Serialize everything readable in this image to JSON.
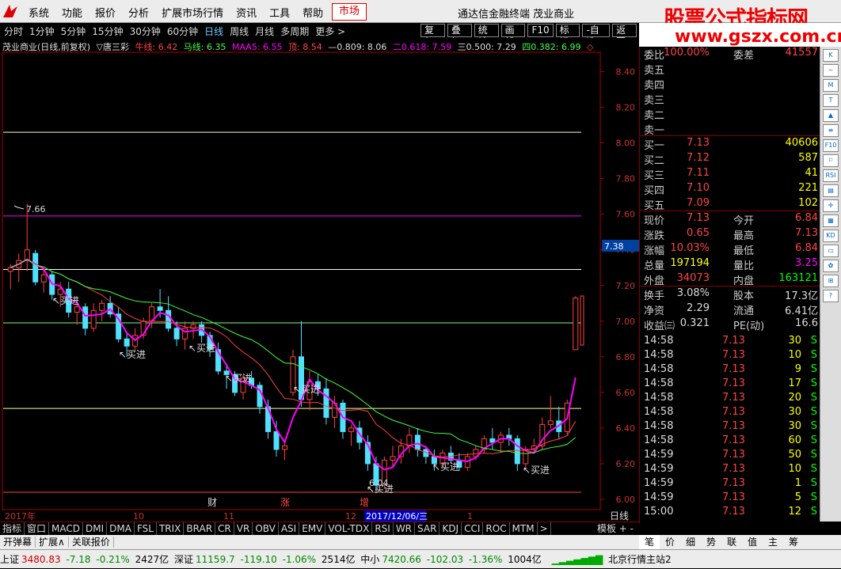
{
  "menubar": {
    "items": [
      "系统",
      "功能",
      "报价",
      "分析",
      "扩展市场行情",
      "资讯",
      "工具",
      "帮助"
    ],
    "active": "市场",
    "title": "通达信金融终端 茂业商业",
    "brand": "股票公式指标网"
  },
  "urlbar": {
    "url": "www.gszx.com.cn"
  },
  "toolbar": {
    "periods": [
      "分时",
      "1分钟",
      "5分钟",
      "15分钟",
      "30分钟",
      "60分钟",
      "日线",
      "周线",
      "月线",
      "多周期",
      "更多 >"
    ],
    "selected": "日线",
    "tools": [
      "复权",
      "叠加",
      "统计",
      "画线",
      "F10",
      "标记",
      "-自选",
      "返回"
    ]
  },
  "legend": {
    "name": "茂业商业(日线,前复权)",
    "indicator": "▽唐三彩",
    "niu": "牛线: 6.42",
    "ma": "马线: 6.35",
    "maa": "MAA5: 6.55",
    "ding": "顶: 8.54",
    "g809": "—0.809: 8.06",
    "g618": "二0.618: 7.59",
    "g500": "三0.500: 7.29",
    "g382": "四0.382: 6.99"
  },
  "chart_data": {
    "type": "candlestick",
    "dates": [
      "2017年",
      "10",
      "11",
      "12",
      "2017/12/06/三",
      "1"
    ],
    "yticks": [
      8.4,
      8.2,
      8.0,
      7.8,
      7.6,
      7.4,
      7.2,
      7.0,
      6.8,
      6.6,
      6.4,
      6.2,
      6.0
    ],
    "ylim": [
      5.96,
      8.5
    ],
    "current_price": 7.38,
    "annotations": {
      "high_label": "7.66",
      "low_label": "6.04",
      "buy_label": "买进",
      "events": [
        "财",
        "涨",
        "增"
      ],
      "period_label": "日线"
    },
    "levels": [
      {
        "value": 8.06,
        "color": "#ffffc0"
      },
      {
        "value": 7.59,
        "color": "#ff00ff"
      },
      {
        "value": 7.29,
        "color": "#ffffff"
      },
      {
        "value": 6.99,
        "color": "#80ff80"
      },
      {
        "value": 6.51,
        "color": "#ffffa0"
      },
      {
        "value": 6.04,
        "color": "#ff4040"
      }
    ],
    "candles": [
      [
        7.28,
        7.32,
        7.18,
        7.3
      ],
      [
        7.3,
        7.38,
        7.22,
        7.34
      ],
      [
        7.34,
        7.66,
        7.28,
        7.4
      ],
      [
        7.38,
        7.4,
        7.2,
        7.22
      ],
      [
        7.22,
        7.3,
        7.16,
        7.26
      ],
      [
        7.26,
        7.28,
        7.12,
        7.15
      ],
      [
        7.15,
        7.22,
        7.08,
        7.18
      ],
      [
        7.18,
        7.22,
        7.02,
        7.05
      ],
      [
        7.05,
        7.12,
        6.98,
        7.08
      ],
      [
        7.08,
        7.1,
        6.92,
        6.96
      ],
      [
        6.96,
        7.1,
        6.94,
        7.06
      ],
      [
        7.06,
        7.12,
        7.0,
        7.1
      ],
      [
        7.1,
        7.14,
        7.02,
        7.04
      ],
      [
        7.04,
        7.08,
        6.88,
        6.9
      ],
      [
        6.9,
        6.94,
        6.8,
        6.86
      ],
      [
        6.86,
        6.96,
        6.84,
        6.92
      ],
      [
        6.92,
        7.02,
        6.9,
        7.0
      ],
      [
        7.0,
        7.1,
        6.96,
        7.08
      ],
      [
        7.08,
        7.18,
        7.02,
        7.06
      ],
      [
        7.06,
        7.14,
        6.94,
        6.96
      ],
      [
        6.96,
        7.0,
        6.86,
        6.9
      ],
      [
        6.9,
        7.0,
        6.84,
        6.96
      ],
      [
        6.96,
        7.0,
        6.9,
        6.98
      ],
      [
        6.98,
        7.0,
        6.88,
        6.92
      ],
      [
        6.92,
        6.94,
        6.8,
        6.84
      ],
      [
        6.84,
        6.88,
        6.7,
        6.72
      ],
      [
        6.72,
        6.76,
        6.62,
        6.7
      ],
      [
        6.7,
        6.72,
        6.58,
        6.6
      ],
      [
        6.6,
        6.7,
        6.56,
        6.68
      ],
      [
        6.68,
        6.72,
        6.62,
        6.64
      ],
      [
        6.64,
        6.66,
        6.48,
        6.52
      ],
      [
        6.52,
        6.56,
        6.34,
        6.38
      ],
      [
        6.38,
        6.44,
        6.24,
        6.28
      ],
      [
        6.28,
        6.32,
        6.22,
        6.3
      ],
      [
        6.6,
        6.84,
        6.58,
        6.8
      ],
      [
        6.8,
        7.0,
        6.52,
        6.56
      ],
      [
        6.56,
        6.72,
        6.5,
        6.66
      ],
      [
        6.66,
        6.7,
        6.58,
        6.62
      ],
      [
        6.62,
        6.68,
        6.42,
        6.46
      ],
      [
        6.46,
        6.58,
        6.4,
        6.54
      ],
      [
        6.54,
        6.56,
        6.34,
        6.38
      ],
      [
        6.38,
        6.42,
        6.3,
        6.4
      ],
      [
        6.4,
        6.44,
        6.28,
        6.32
      ],
      [
        6.32,
        6.36,
        6.16,
        6.2
      ],
      [
        6.2,
        6.24,
        6.04,
        6.08
      ],
      [
        6.08,
        6.24,
        6.06,
        6.22
      ],
      [
        6.22,
        6.3,
        6.18,
        6.24
      ],
      [
        6.24,
        6.34,
        6.2,
        6.3
      ],
      [
        6.3,
        6.4,
        6.26,
        6.36
      ],
      [
        6.36,
        6.4,
        6.24,
        6.28
      ],
      [
        6.28,
        6.3,
        6.2,
        6.24
      ],
      [
        6.24,
        6.28,
        6.16,
        6.2
      ],
      [
        6.2,
        6.28,
        6.18,
        6.26
      ],
      [
        6.26,
        6.3,
        6.2,
        6.22
      ],
      [
        6.22,
        6.26,
        6.16,
        6.18
      ],
      [
        6.18,
        6.26,
        6.16,
        6.24
      ],
      [
        6.24,
        6.3,
        6.22,
        6.28
      ],
      [
        6.28,
        6.36,
        6.26,
        6.34
      ],
      [
        6.34,
        6.4,
        6.28,
        6.32
      ],
      [
        6.32,
        6.38,
        6.26,
        6.36
      ],
      [
        6.36,
        6.4,
        6.3,
        6.34
      ],
      [
        6.34,
        6.36,
        6.16,
        6.2
      ],
      [
        6.2,
        6.3,
        6.18,
        6.28
      ],
      [
        6.28,
        6.34,
        6.26,
        6.3
      ],
      [
        6.3,
        6.46,
        6.28,
        6.42
      ],
      [
        6.42,
        6.58,
        6.4,
        6.44
      ],
      [
        6.44,
        6.52,
        6.34,
        6.38
      ],
      [
        6.38,
        6.56,
        6.36,
        6.54
      ],
      [
        6.84,
        7.14,
        6.84,
        7.13
      ]
    ]
  },
  "quote": {
    "rows": [
      {
        "a": "委比",
        "b": "100.00%",
        "c": "委差",
        "d": "41557",
        "bc": "#f44",
        "dc": "#f44"
      },
      {
        "a": "卖五",
        "b": "",
        "c": "",
        "d": ""
      },
      {
        "a": "卖四",
        "b": "",
        "c": "",
        "d": ""
      },
      {
        "a": "卖三",
        "b": "",
        "c": "",
        "d": ""
      },
      {
        "a": "卖二",
        "b": "",
        "c": "",
        "d": ""
      },
      {
        "a": "卖一",
        "b": "",
        "c": "",
        "d": ""
      },
      {
        "a": "买一",
        "b": "7.13",
        "c": "",
        "d": "40606",
        "bc": "#f44",
        "dc": "#ff0"
      },
      {
        "a": "买二",
        "b": "7.12",
        "c": "",
        "d": "587",
        "bc": "#f44",
        "dc": "#ff0"
      },
      {
        "a": "买三",
        "b": "7.11",
        "c": "",
        "d": "41",
        "bc": "#f44",
        "dc": "#ff0"
      },
      {
        "a": "买四",
        "b": "7.10",
        "c": "",
        "d": "221",
        "bc": "#f44",
        "dc": "#ff0"
      },
      {
        "a": "买五",
        "b": "7.09",
        "c": "",
        "d": "102",
        "bc": "#f44",
        "dc": "#ff0"
      },
      {
        "a": "现价",
        "b": "7.13",
        "c": "今开",
        "d": "6.84",
        "bc": "#f44",
        "dc": "#f44"
      },
      {
        "a": "涨跌",
        "b": "0.65",
        "c": "最高",
        "d": "7.13",
        "bc": "#f44",
        "dc": "#f44"
      },
      {
        "a": "涨幅",
        "b": "10.03%",
        "c": "最低",
        "d": "6.84",
        "bc": "#f44",
        "dc": "#f44"
      },
      {
        "a": "总量",
        "b": "197194",
        "c": "量比",
        "d": "3.25",
        "bc": "#ff0",
        "dc": "#f0f"
      },
      {
        "a": "外盘",
        "b": "34073",
        "c": "内盘",
        "d": "163121",
        "bc": "#f44",
        "dc": "#0f0"
      },
      {
        "a": "换手",
        "b": "3.08%",
        "c": "股本",
        "d": "17.3亿",
        "bc": "#ddd",
        "dc": "#ddd"
      },
      {
        "a": "净资",
        "b": "2.29",
        "c": "流通",
        "d": "6.41亿",
        "bc": "#ddd",
        "dc": "#ddd"
      },
      {
        "a": "收益㈢",
        "b": "0.321",
        "c": "PE(动)",
        "d": "16.6",
        "bc": "#ddd",
        "dc": "#ddd"
      }
    ],
    "ticks": [
      {
        "t": "14:58",
        "p": "7.13",
        "v": "30",
        "s": "S"
      },
      {
        "t": "14:58",
        "p": "7.13",
        "v": "10",
        "s": "S"
      },
      {
        "t": "14:58",
        "p": "7.13",
        "v": "9",
        "s": "S"
      },
      {
        "t": "14:58",
        "p": "7.13",
        "v": "17",
        "s": "S"
      },
      {
        "t": "14:58",
        "p": "7.13",
        "v": "20",
        "s": "S"
      },
      {
        "t": "14:58",
        "p": "7.13",
        "v": "30",
        "s": "S"
      },
      {
        "t": "14:58",
        "p": "7.13",
        "v": "30",
        "s": "S"
      },
      {
        "t": "14:58",
        "p": "7.13",
        "v": "60",
        "s": "S"
      },
      {
        "t": "14:59",
        "p": "7.13",
        "v": "50",
        "s": "S"
      },
      {
        "t": "14:59",
        "p": "7.13",
        "v": "10",
        "s": "S"
      },
      {
        "t": "14:59",
        "p": "7.13",
        "v": "1",
        "s": "S"
      },
      {
        "t": "14:59",
        "p": "7.13",
        "v": "5",
        "s": "S"
      },
      {
        "t": "15:00",
        "p": "7.13",
        "v": "12",
        "s": "S"
      }
    ]
  },
  "sidebar": {
    "icons": [
      "K",
      "~",
      "M",
      "T",
      "▲",
      "≡",
      "F10",
      "⚐",
      "RSI",
      "▤",
      "✛",
      "▦",
      "KD",
      "▭",
      "✿",
      "⊞",
      "?"
    ]
  },
  "indbar": {
    "items": [
      "指标",
      "窗口",
      "MACD",
      "DMI",
      "DMA",
      "FSL",
      "TRIX",
      "BRAR",
      "CR",
      "VR",
      "OBV",
      "ASI",
      "EMV",
      "VOL-TDX",
      "RSI",
      "WR",
      "SAR",
      "KDJ",
      "CCI",
      "ROC",
      "MTM",
      ">"
    ],
    "right": "模板  +  -"
  },
  "row2": {
    "items": [
      "开弹幕",
      "扩展∧",
      "关联报价"
    ]
  },
  "qtabs": {
    "items": [
      "笔",
      "价",
      "细",
      "势",
      "联",
      "值",
      "主",
      "筹"
    ]
  },
  "status": {
    "sh": "上证",
    "shv": "3480.83",
    "shc": "-7.18",
    "shp": "-0.21%",
    "sha": "2427亿",
    "sz": "深证",
    "szv": "11159.7",
    "szc": "-119.10",
    "szp": "-1.06%",
    "sza": "2514亿",
    "zx": "中小",
    "zxv": "7420.66",
    "zxc": "-102.03",
    "zxp": "-1.36%",
    "zxa": "1004亿",
    "site": "北京行情主站2"
  }
}
